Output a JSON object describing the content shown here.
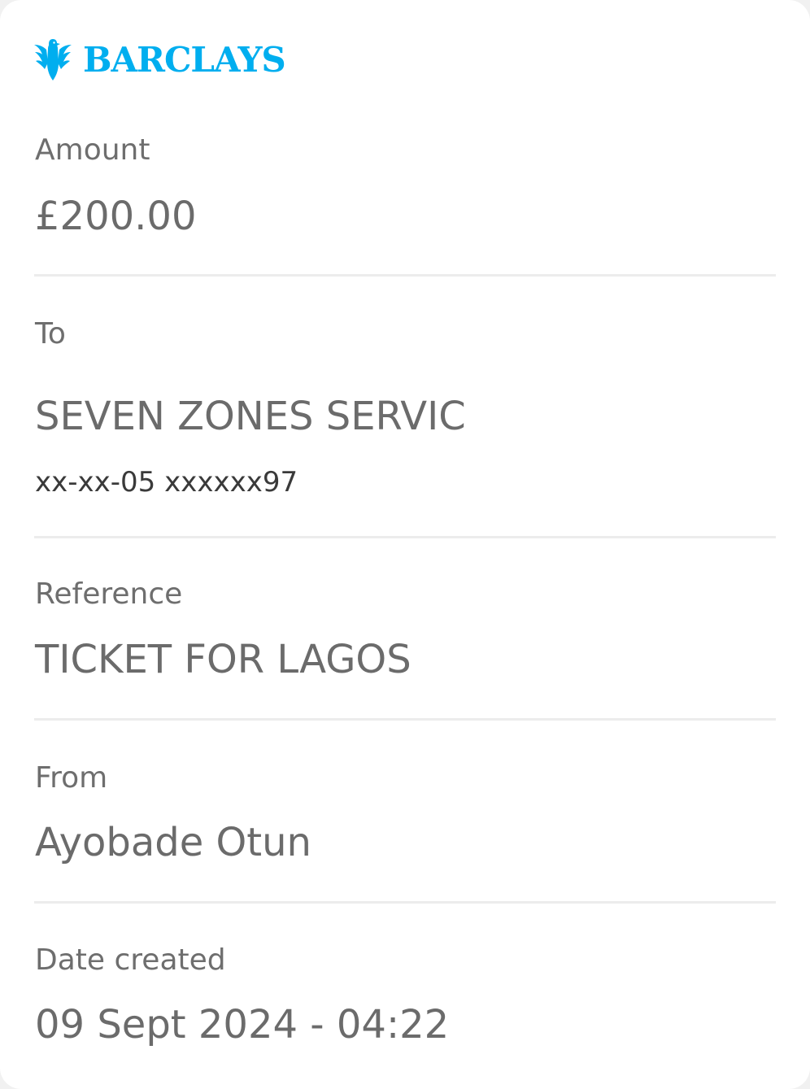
{
  "brand": {
    "name": "BARCLAYS",
    "logo_icon": "eagle-icon",
    "color": "#00aeef"
  },
  "amount": {
    "label": "Amount",
    "value": "£200.00"
  },
  "to": {
    "label": "To",
    "name": "SEVEN ZONES SERVIC",
    "account": "xx-xx-05 xxxxxx97"
  },
  "reference": {
    "label": "Reference",
    "value": "TICKET FOR LAGOS"
  },
  "from": {
    "label": "From",
    "value": "Ayobade Otun"
  },
  "date_created": {
    "label": "Date created",
    "value": "09 Sept 2024 - 04:22"
  }
}
